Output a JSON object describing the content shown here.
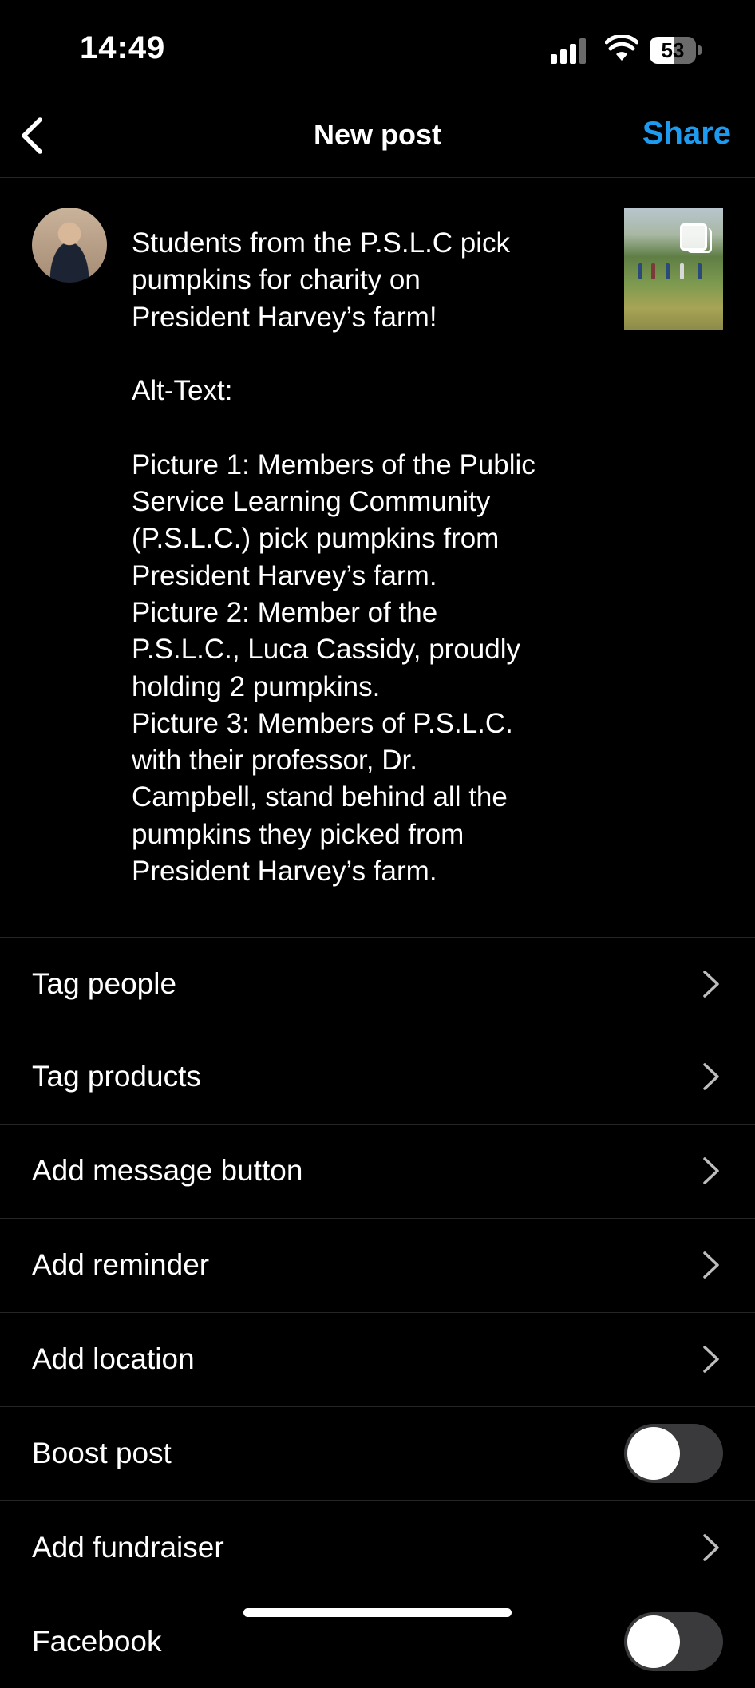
{
  "status_bar": {
    "time": "14:49",
    "battery": "53"
  },
  "header": {
    "title": "New post",
    "share_label": "Share"
  },
  "caption": "Students from the P.S.L.C pick\npumpkins for charity on\nPresident Harvey’s farm!\n\nAlt-Text:\n\nPicture 1: Members of the Public\nService Learning Community\n(P.S.L.C.) pick pumpkins from\nPresident Harvey’s farm.\nPicture 2: Member of the\nP.S.L.C., Luca Cassidy, proudly\nholding 2 pumpkins.\nPicture 3: Members of P.S.L.C.\nwith their professor, Dr.\nCampbell, stand behind all the\npumpkins they picked from\nPresident Harvey’s farm.",
  "options": [
    {
      "label": "Tag people",
      "type": "chevron"
    },
    {
      "label": "Tag products",
      "type": "chevron"
    },
    {
      "label": "Add message button",
      "type": "chevron"
    },
    {
      "label": "Add reminder",
      "type": "chevron"
    },
    {
      "label": "Add location",
      "type": "chevron"
    },
    {
      "label": "Boost post",
      "type": "toggle",
      "on": false
    },
    {
      "label": "Add fundraiser",
      "type": "chevron"
    },
    {
      "label": "Facebook",
      "type": "toggle",
      "on": false
    }
  ],
  "colors": {
    "accent": "#1d9bf0",
    "background": "#000000",
    "separator": "#262626",
    "toggle_off": "#3a3a3c"
  }
}
